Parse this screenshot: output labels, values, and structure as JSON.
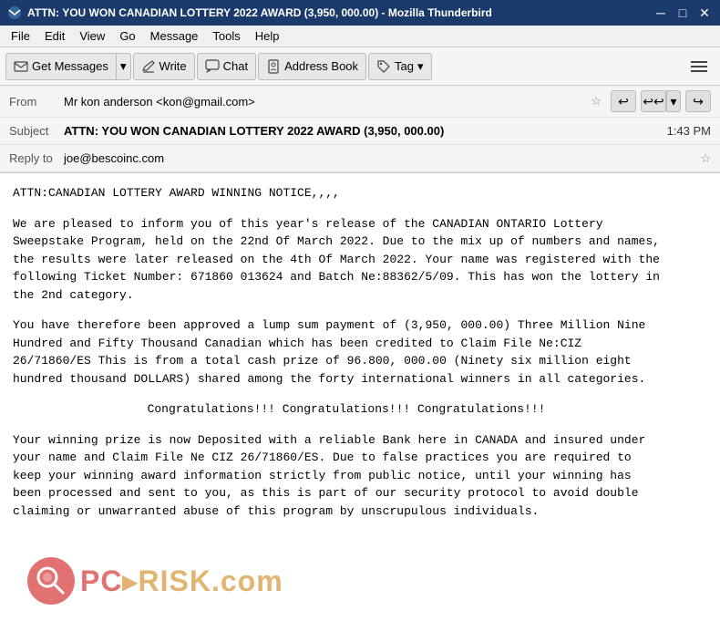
{
  "titleBar": {
    "title": "ATTN: YOU WON CANADIAN LOTTERY 2022 AWARD (3,950, 000.00) - Mozilla Thunderbird",
    "minimize": "─",
    "maximize": "□",
    "close": "✕"
  },
  "menuBar": {
    "items": [
      "File",
      "Edit",
      "View",
      "Go",
      "Message",
      "Tools",
      "Help"
    ]
  },
  "toolbar": {
    "getMessages": "Get Messages",
    "write": "Write",
    "chat": "Chat",
    "addressBook": "Address Book",
    "tag": "Tag"
  },
  "emailHeader": {
    "fromLabel": "From",
    "fromValue": "Mr kon anderson <kon@gmail.com>",
    "subjectLabel": "Subject",
    "subjectValue": "ATTN: YOU WON CANADIAN LOTTERY 2022 AWARD (3,950, 000.00)",
    "timestamp": "1:43 PM",
    "replyToLabel": "Reply to",
    "replyToValue": "joe@bescoinc.com"
  },
  "emailBody": {
    "paragraph1": "ATTN:CANADIAN LOTTERY AWARD WINNING NOTICE,,,,",
    "paragraph2": "We are pleased to inform you of this year's release of the CANADIAN ONTARIO Lottery Sweepstake Program, held on the 22nd Of March 2022. Due to the mix up of numbers and names, the results were later released on the 4th Of March 2022. Your name was registered with the following Ticket Number: 671860 013624 and Batch Ne:88362/5/09. This has won the lottery in the 2nd category.",
    "paragraph3": "You have therefore been approved a lump sum payment of (3,950, 000.00) Three Million Nine Hundred and Fifty Thousand Canadian which has been credited to Claim File Ne:CIZ 26/71860/ES This is from a total cash prize of 96.800, 000.00 (Ninety six million eight hundred thousand DOLLARS) shared among the forty international winners in all categories.",
    "paragraph4": "Congratulations!!! Congratulations!!! Congratulations!!!",
    "paragraph5": "Your winning prize is now Deposited with a reliable Bank here in CANADA and insured under your name and Claim File Ne CIZ 26/71860/ES. Due to false practices you are required to keep your winning award information strictly from public notice, until your winning has been processed and sent to you, as this is part of our security protocol to avoid double claiming or unwarranted abuse of this program by unscrupulous individuals."
  },
  "watermark": {
    "text": "RISK.com",
    "prefix": "PC"
  }
}
